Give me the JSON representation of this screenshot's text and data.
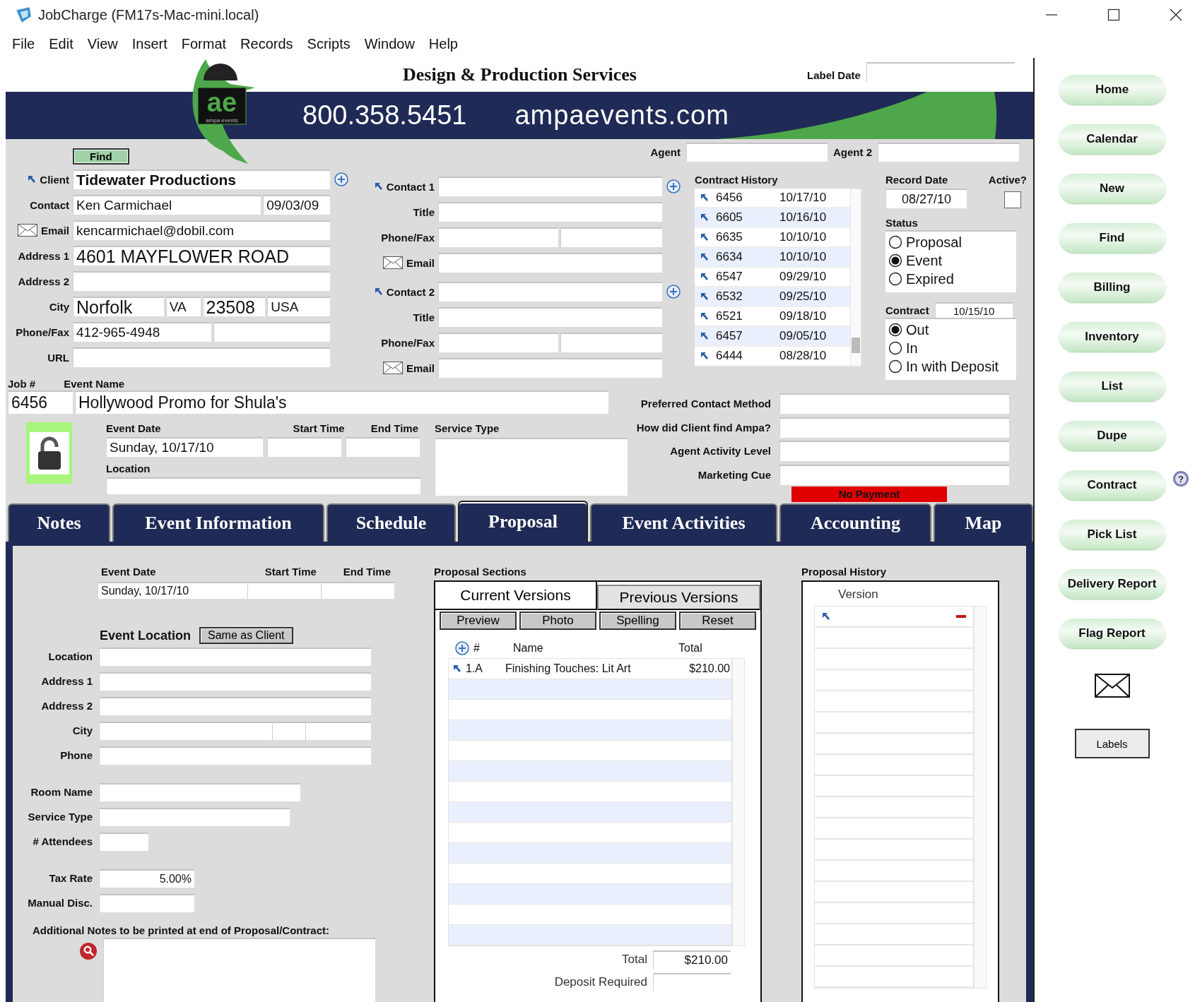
{
  "window": {
    "title": "JobCharge (FM17s-Mac-mini.local)"
  },
  "menu": [
    "File",
    "Edit",
    "View",
    "Insert",
    "Format",
    "Records",
    "Scripts",
    "Window",
    "Help"
  ],
  "header": {
    "title": "Design & Production Services",
    "label_date": "Label Date",
    "phone": "800.358.5451",
    "website": "ampaevents.com",
    "logo_mark": "ae",
    "logo_caption": "ampa events"
  },
  "find_button": "Find",
  "agents": [
    "Agent",
    "Agent 2"
  ],
  "client_rows": [
    {
      "label": "Client",
      "kind": "lookup",
      "values": [
        "Tidewater Productions"
      ]
    },
    {
      "label": "Contact",
      "kind": "dated",
      "values": [
        "Ken Carmichael",
        "09/03/09"
      ]
    },
    {
      "label": "Email",
      "kind": "email",
      "values": [
        "kencarmichael@dobil.com"
      ]
    },
    {
      "label": "Address 1",
      "kind": "large",
      "values": [
        "4601 MAYFLOWER ROAD"
      ]
    },
    {
      "label": "Address 2",
      "kind": "plain"
    },
    {
      "label": "City",
      "kind": "city",
      "values": [
        "Norfolk",
        "VA",
        "23508",
        "USA"
      ]
    },
    {
      "label": "Phone/Fax",
      "kind": "split",
      "values": [
        "412-965-4948"
      ]
    },
    {
      "label": "URL",
      "kind": "plain"
    }
  ],
  "contact_rows": [
    {
      "label": "Contact 1",
      "kind": "lookup"
    },
    {
      "label": "Title",
      "kind": "plain"
    },
    {
      "label": "Phone/Fax",
      "kind": "split"
    },
    {
      "label": "Email",
      "kind": "email"
    },
    {
      "label": "Contact 2",
      "kind": "lookup"
    },
    {
      "label": "Title",
      "kind": "plain"
    },
    {
      "label": "Phone/Fax",
      "kind": "split"
    },
    {
      "label": "Email",
      "kind": "email"
    }
  ],
  "contract_history": {
    "title": "Contract History",
    "rows": [
      {
        "job": "6456",
        "date": "10/17/10"
      },
      {
        "job": "6605",
        "date": "10/16/10"
      },
      {
        "job": "6635",
        "date": "10/10/10"
      },
      {
        "job": "6634",
        "date": "10/10/10"
      },
      {
        "job": "6547",
        "date": "09/29/10"
      },
      {
        "job": "6532",
        "date": "09/25/10"
      },
      {
        "job": "6521",
        "date": "09/18/10"
      },
      {
        "job": "6457",
        "date": "09/05/10"
      },
      {
        "job": "6444",
        "date": "08/28/10"
      }
    ]
  },
  "record": {
    "record_date_label": "Record Date",
    "record_date": "08/27/10",
    "active_label": "Active?",
    "active": false,
    "status_label": "Status",
    "status": [
      {
        "label": "Proposal",
        "selected": false
      },
      {
        "label": "Event",
        "selected": true
      },
      {
        "label": "Expired",
        "selected": false
      }
    ],
    "contract_label": "Contract",
    "contract_date": "10/15/10",
    "contract": [
      {
        "label": "Out",
        "selected": true
      },
      {
        "label": "In",
        "selected": false
      },
      {
        "label": "In with Deposit",
        "selected": false
      }
    ]
  },
  "job": {
    "job_label": "Job #",
    "job": "6456",
    "name_label": "Event Name",
    "name": "Hollywood Promo for Shula's",
    "date_label": "Event Date",
    "date": "Sunday, 10/17/10",
    "start_label": "Start Time",
    "end_label": "End Time",
    "location_label": "Location",
    "service_label": "Service Type"
  },
  "marketing": [
    "Preferred Contact Method",
    "How did Client find Ampa?",
    "Agent Activity Level",
    "Marketing Cue"
  ],
  "payment_status": "No Payment",
  "tabs": [
    {
      "label": "Notes",
      "selected": false
    },
    {
      "label": "Event Information",
      "selected": false
    },
    {
      "label": "Schedule",
      "selected": false
    },
    {
      "label": "Proposal",
      "selected": true
    },
    {
      "label": "Event Activities",
      "selected": false
    },
    {
      "label": "Accounting",
      "selected": false
    },
    {
      "label": "Map",
      "selected": false
    }
  ],
  "event": {
    "date_label": "Event Date",
    "start_label": "Start Time",
    "end_label": "End Time",
    "date": "Sunday, 10/17/10",
    "location_title": "Event Location",
    "same_button": "Same as Client"
  },
  "location_groups": [
    [
      {
        "label": "Location",
        "kind": "wide"
      },
      {
        "label": "Address 1",
        "kind": "wide"
      },
      {
        "label": "Address 2",
        "kind": "wide"
      },
      {
        "label": "City",
        "kind": "city"
      },
      {
        "label": "Phone",
        "kind": "wide"
      }
    ],
    [
      {
        "label": "Room Name",
        "kind": "medium"
      },
      {
        "label": "Service Type",
        "kind": "medium2"
      },
      {
        "label": "# Attendees",
        "kind": "short"
      }
    ],
    [
      {
        "label": "Tax Rate",
        "kind": "number",
        "value": "5.00%"
      },
      {
        "label": "Manual Disc.",
        "kind": "number"
      }
    ]
  ],
  "notes_label": "Additional Notes to be printed at end of Proposal/Contract:",
  "proposal_sections": {
    "title": "Proposal Sections",
    "tabs": [
      {
        "label": "Current Versions",
        "selected": true
      },
      {
        "label": "Previous Versions",
        "selected": false
      }
    ],
    "buttons": [
      "Preview",
      "Photo",
      "Spelling",
      "Reset"
    ],
    "columns": [
      "#",
      "Name",
      "Total"
    ],
    "rows": [
      {
        "num": "1.A",
        "name": "Finishing Touches:  Lit Art",
        "total": "$210.00"
      }
    ],
    "total_label": "Total",
    "total": "$210.00",
    "deposit_label": "Deposit Required"
  },
  "proposal_history": {
    "title": "Proposal History",
    "column": "Version"
  },
  "sidebar": [
    {
      "label": "Home",
      "kind": "pill"
    },
    {
      "label": "Calendar",
      "kind": "pill"
    },
    {
      "label": "New",
      "kind": "pill"
    },
    {
      "label": "Find",
      "kind": "pill"
    },
    {
      "label": "Billing",
      "kind": "pill"
    },
    {
      "label": "Inventory",
      "kind": "pill"
    },
    {
      "label": "List",
      "kind": "pill"
    },
    {
      "label": "Dupe",
      "kind": "pill"
    },
    {
      "label": "Contract",
      "kind": "pill",
      "help": "?"
    },
    {
      "label": "Pick List",
      "kind": "pill"
    },
    {
      "label": "Delivery Report",
      "kind": "pill"
    },
    {
      "label": "Flag Report",
      "kind": "pill"
    },
    {
      "kind": "mail"
    },
    {
      "label": "Labels",
      "kind": "square"
    }
  ]
}
